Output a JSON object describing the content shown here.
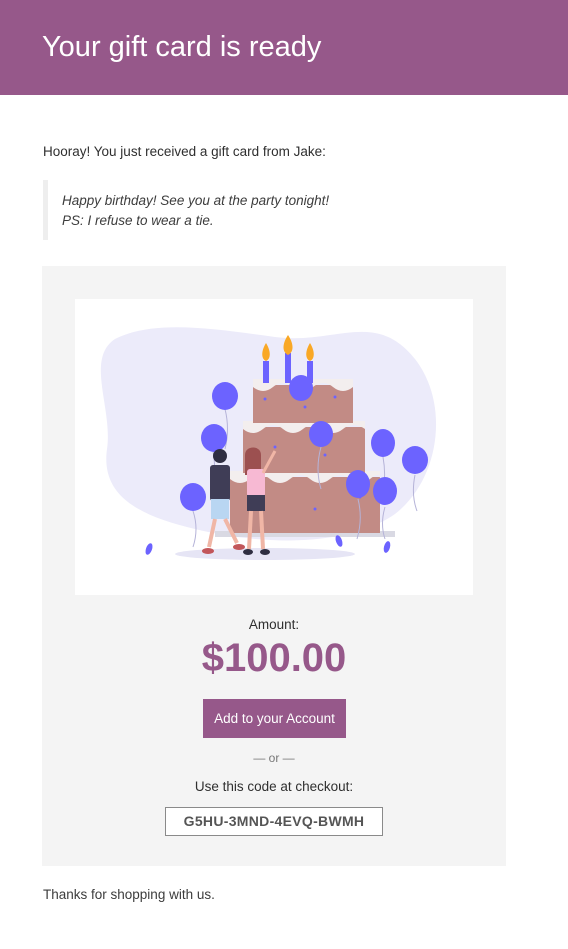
{
  "header": {
    "title": "Your gift card is ready"
  },
  "message": {
    "intro": "Hooray! You just received a gift card from Jake:",
    "quote_lines": [
      "Happy birthday! See you at the party tonight!",
      "PS: I refuse to wear a tie."
    ]
  },
  "gift_card": {
    "image_icon": "birthday-cake-illustration",
    "amount_label": "Amount:",
    "amount_value": "$100.00",
    "redeem_button_label": "Add to your Account",
    "or_divider": "— or —",
    "code_label": "Use this code at checkout:",
    "code": "G5HU-3MND-4EVQ-BWMH"
  },
  "footer": {
    "thanks": "Thanks for shopping with us."
  },
  "colors": {
    "brand": "#96588a",
    "card_background": "#f4f4f4",
    "balloon": "#6c63ff",
    "cake": "#c28b85"
  }
}
